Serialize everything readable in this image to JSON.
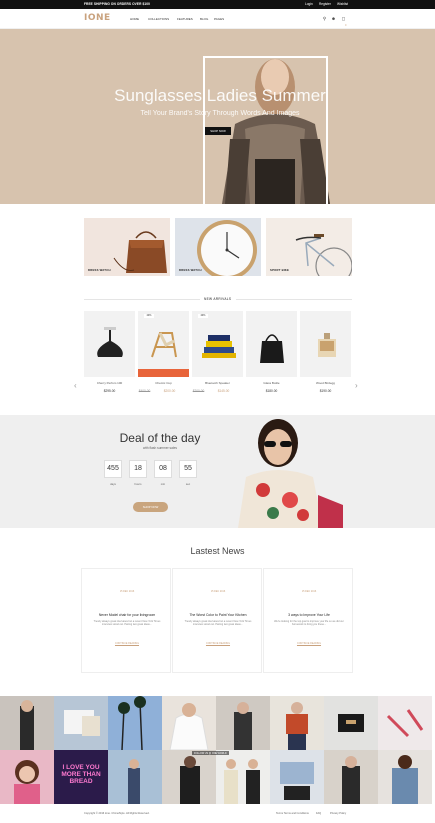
{
  "topbar": {
    "promo": "FREE SHIPPING ON ORDERS OVER $100",
    "login": "Login",
    "register": "Register",
    "wishlist": "Wishlist"
  },
  "header": {
    "logo": "IONE",
    "nav": [
      "HOME",
      "COLLECTIONS",
      "FEATURES",
      "BLOG",
      "PAGES"
    ],
    "cart_count": "0"
  },
  "hero": {
    "title": "Sunglasses Ladies Summer",
    "subtitle": "Tell Your Brand's Story Through Words And Images",
    "button": "SHOP NOW"
  },
  "categories": [
    {
      "label": "DRESS WATCH"
    },
    {
      "label": "DRESS WATCH"
    },
    {
      "label": "SPORT BIKE"
    }
  ],
  "new_arrivals": {
    "heading": "NEW ARRIVALS",
    "products": [
      {
        "name": "Cherry Perfum 100",
        "price": "$295.00",
        "old_price": "",
        "badge": ""
      },
      {
        "name": "Chemix Cup",
        "price": "$200.00",
        "old_price": "$400.00",
        "badge": "20%"
      },
      {
        "name": "Bluetooth Speaker",
        "price": "$145.00",
        "old_price": "$200.00",
        "badge": "20%"
      },
      {
        "name": "Glass Bottle",
        "price": "$180.00",
        "old_price": "",
        "badge": ""
      },
      {
        "name": "Wood Birdegg",
        "price": "$190.00",
        "old_price": "",
        "badge": ""
      }
    ]
  },
  "deal": {
    "title": "Deal of the day",
    "subtitle": "with flash summer sales",
    "countdown": [
      {
        "value": "455",
        "label": "days"
      },
      {
        "value": "18",
        "label": "hours"
      },
      {
        "value": "08",
        "label": "min"
      },
      {
        "value": "55",
        "label": "sec"
      }
    ],
    "button": "SHOP NOW"
  },
  "news": {
    "heading": "Lastest News",
    "cards": [
      {
        "date": "15 DEC 2016",
        "title": "Never Model chair for your livingroom",
        "excerpt": "Trendy always great interviews but a recent New York Times interview stood out. Pairing two great ideas...",
        "more": "CONTINUE READING"
      },
      {
        "date": "15 DEC 2016",
        "title": "The Worst Color to Paint Your Kitchen",
        "excerpt": "Trendy always great interviews but a recent New York Times interview stood out. Pairing two great ideas...",
        "more": "CONTINUE READING"
      },
      {
        "date": "15 DEC 2016",
        "title": "3 ways to Improve Your Life",
        "excerpt": "We're looking for the top goal to improve your life so we did our homework to bring you these...",
        "more": "CONTINUE READING"
      }
    ]
  },
  "instagram": {
    "caption": "FOLLOW US @ ONE WORLD",
    "neon_text": "I LOVE YOU MORE THAN BREAD"
  },
  "footer": {
    "copyright": "Copyright © 2016 Ione. ChimeStyle. All Rights Reserved.",
    "links": [
      "Terms Terms and Conditions",
      "FAQ",
      "Privacy Policy"
    ]
  },
  "colors": {
    "accent": "#c9a27e",
    "hero_bg": "#d7c3ae",
    "deal_bg": "#efefef",
    "sale_red": "#e8643a"
  }
}
